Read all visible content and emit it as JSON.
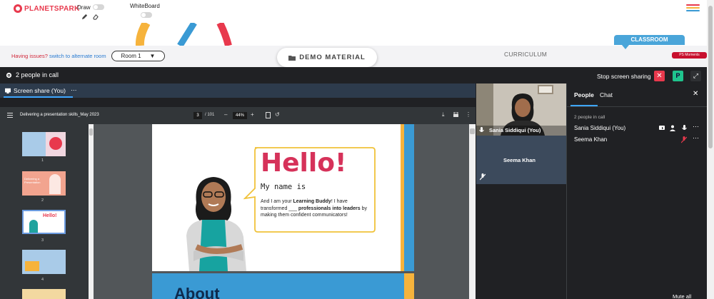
{
  "app": {
    "logo_text": "PLANETSPARK",
    "draw_label": "Draw",
    "whiteboard_label": "WhiteBoard"
  },
  "colors": {
    "brand_red": "#e8394d",
    "meet_bg": "#202124",
    "accent_blue": "#4aa5d9"
  },
  "session": {
    "issue_text": "Having issues?",
    "issue_link": "switch to alternate room",
    "room_value": "Room 1",
    "demo_material": "DEMO MATERIAL",
    "curriculum": "CURRICULUM",
    "classroom_tab": "CLASSROOM",
    "ps_moments": "PS Moments"
  },
  "meet": {
    "people_in_call": "2 people in call",
    "stop_sharing": "Stop screen sharing",
    "p_badge": "P",
    "share_tab": "Screen share (You)",
    "share_more": "⋯"
  },
  "pdf": {
    "file_name": "Delivering a presentation skills_May 2023",
    "current_page": "3",
    "total_pages": "/ 101",
    "zoom": "44%",
    "thumb_numbers": [
      "1",
      "2",
      "3",
      "4"
    ]
  },
  "slide": {
    "hello": "Hello!",
    "name_line": "My name is",
    "body_prefix": "And I am your ",
    "body_bold1": "Learning Buddy",
    "body_mid": "! I have transformed ___ ",
    "body_bold2": "professionals into leaders",
    "body_suffix": " by making them confident communicators!",
    "next_title": "About"
  },
  "thumb_texts": {
    "t2": "Delivering a Presentation",
    "t3": "Hello!"
  },
  "participants_tiles": {
    "tile1_name": "Sania Siddiqui (You)",
    "tile2_name": "Seema Khan"
  },
  "panel": {
    "tab_people": "People",
    "tab_chat": "Chat",
    "count_label": "2 people in call",
    "people": [
      {
        "name": "Sania Siddiqui (You)"
      },
      {
        "name": "Seema Khan"
      }
    ],
    "mute_all": "Mute all"
  }
}
